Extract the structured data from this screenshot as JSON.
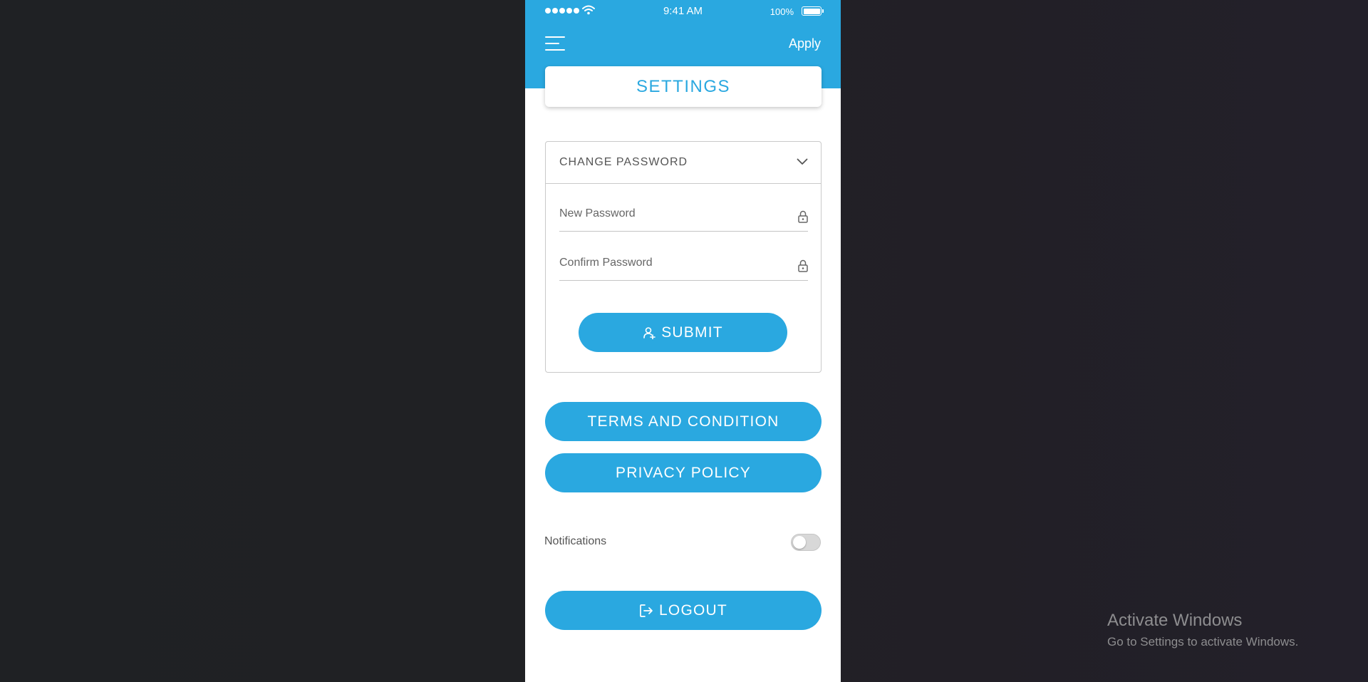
{
  "status_bar": {
    "time": "9:41 AM",
    "battery": "100%"
  },
  "header": {
    "menu_icon": "hamburger-menu-icon",
    "apply_label": "Apply"
  },
  "page": {
    "title": "SETTINGS"
  },
  "change_password": {
    "title": "CHANGE PASSWORD",
    "new_password": {
      "value": "",
      "placeholder": "New Password"
    },
    "confirm_password": {
      "value": "",
      "placeholder": "Confirm Password"
    },
    "submit_label": "SUBMIT"
  },
  "links": {
    "terms_label": "TERMS AND CONDITION",
    "privacy_label": "PRIVACY POLICY"
  },
  "notifications": {
    "label": "Notifications",
    "enabled": false
  },
  "logout_label": "LOGOUT",
  "watermark": {
    "title": "Activate Windows",
    "subtitle": "Go to Settings to activate Windows."
  },
  "colors": {
    "accent": "#2aa8e0",
    "background": "#202124",
    "card": "#ffffff",
    "text": "#555555"
  }
}
